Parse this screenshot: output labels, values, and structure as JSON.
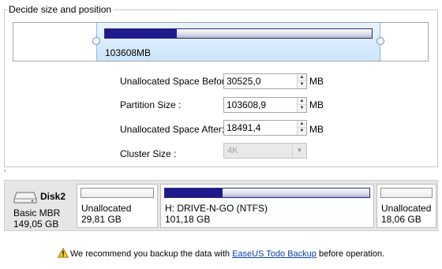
{
  "group": {
    "title": "Decide size and position"
  },
  "slider": {
    "size_label": "103608MB",
    "used_fraction": 0.27
  },
  "form": {
    "before_label": "Unallocated Space Before:",
    "before_value": "30525,0",
    "size_label": "Partition Size :",
    "size_value": "103608,9",
    "after_label": "Unallocated Space After:",
    "after_value": "18491,4",
    "unit": "MB",
    "cluster_label": "Cluster Size :",
    "cluster_value": "4K"
  },
  "disk": {
    "name": "Disk2",
    "type": "Basic MBR",
    "size": "149,05 GB",
    "partitions": [
      {
        "label": "Unallocated",
        "size": "29,81 GB",
        "used_fraction": 0
      },
      {
        "label": "H: DRIVE-N-GO (NTFS)",
        "size": "101,18 GB",
        "used_fraction": 0.28
      },
      {
        "label": "Unallocated",
        "size": "18,06 GB",
        "used_fraction": 0
      }
    ]
  },
  "footer": {
    "text_before": "We recommend you backup the data with ",
    "link": "EaseUS Todo Backup",
    "text_after": " before operation."
  },
  "icons": {
    "disk": "hard-drive-icon",
    "warning": "warning-icon"
  },
  "colors": {
    "accent": "#1f1a8c",
    "link": "#0b3fb3",
    "selection": "#cbe5fb"
  }
}
